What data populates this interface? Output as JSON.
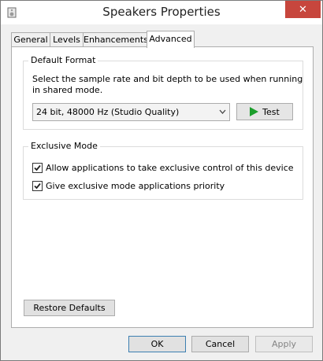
{
  "window": {
    "title": "Speakers Properties",
    "close_symbol": "✕"
  },
  "tabs": [
    {
      "label": "General"
    },
    {
      "label": "Levels"
    },
    {
      "label": "Enhancements"
    },
    {
      "label": "Advanced",
      "active": true
    }
  ],
  "default_format": {
    "group_label": "Default Format",
    "description": "Select the sample rate and bit depth to be used when running in shared mode.",
    "selected_format": "24 bit, 48000 Hz (Studio Quality)",
    "test_label": "Test"
  },
  "exclusive_mode": {
    "group_label": "Exclusive Mode",
    "options": [
      {
        "label": "Allow applications to take exclusive control of this device",
        "checked": true
      },
      {
        "label": "Give exclusive mode applications priority",
        "checked": true
      }
    ]
  },
  "restore_defaults_label": "Restore Defaults",
  "footer": {
    "ok_label": "OK",
    "cancel_label": "Cancel",
    "apply_label": "Apply"
  },
  "icons": {
    "window_icon": "speaker-icon",
    "test_icon": "play-icon",
    "check_icon": "checkmark-icon"
  },
  "colors": {
    "close_button": "#c7463d",
    "play_icon": "#1b9e2b",
    "ok_border": "#3c7fb1"
  }
}
